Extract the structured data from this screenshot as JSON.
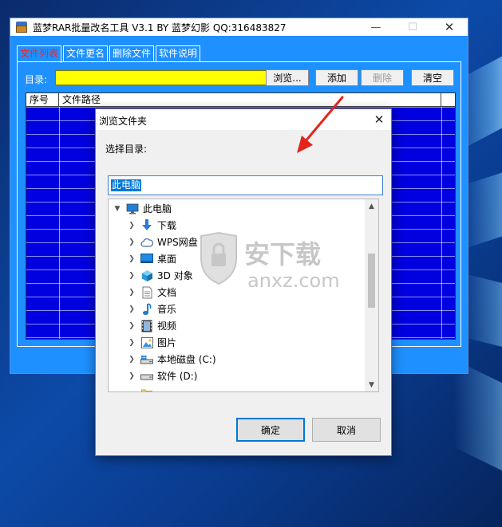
{
  "app": {
    "title": "蓝梦RAR批量改名工具 V3.1 BY 蓝梦幻影 QQ:316483827",
    "tabs": [
      "文件列表",
      "文件更名",
      "删除文件",
      "软件说明"
    ],
    "active_tab": 0,
    "dir_label": "目录:",
    "dir_value": "",
    "buttons": {
      "browse": "浏览...",
      "add": "添加",
      "delete": "删除",
      "clear": "清空"
    },
    "grid": {
      "columns": [
        "序号",
        "文件路径"
      ],
      "rows": []
    },
    "colors": {
      "window_bg": "#1e90ff",
      "grid_bg": "#0000e0",
      "dir_input_bg": "#ffff00",
      "active_tab_text": "#ff2020"
    }
  },
  "dialog": {
    "title": "浏览文件夹",
    "prompt": "选择目录:",
    "selected": "此电脑",
    "tree": [
      {
        "label": "此电脑",
        "icon": "computer-icon",
        "level": 0,
        "expanded": true
      },
      {
        "label": "下载",
        "icon": "download-icon",
        "level": 1
      },
      {
        "label": "WPS网盘",
        "icon": "cloud-icon",
        "level": 1
      },
      {
        "label": "桌面",
        "icon": "desktop-icon",
        "level": 1
      },
      {
        "label": "3D 对象",
        "icon": "cube-icon",
        "level": 1
      },
      {
        "label": "文档",
        "icon": "document-icon",
        "level": 1
      },
      {
        "label": "音乐",
        "icon": "music-icon",
        "level": 1
      },
      {
        "label": "视频",
        "icon": "video-icon",
        "level": 1
      },
      {
        "label": "图片",
        "icon": "picture-icon",
        "level": 1
      },
      {
        "label": "本地磁盘 (C:)",
        "icon": "drive-c-icon",
        "level": 1
      },
      {
        "label": "软件 (D:)",
        "icon": "drive-icon",
        "level": 1
      }
    ],
    "ok_label": "确定",
    "cancel_label": "取消"
  },
  "watermark": {
    "brand_cn": "安下载",
    "brand_en": "anxz.com"
  }
}
